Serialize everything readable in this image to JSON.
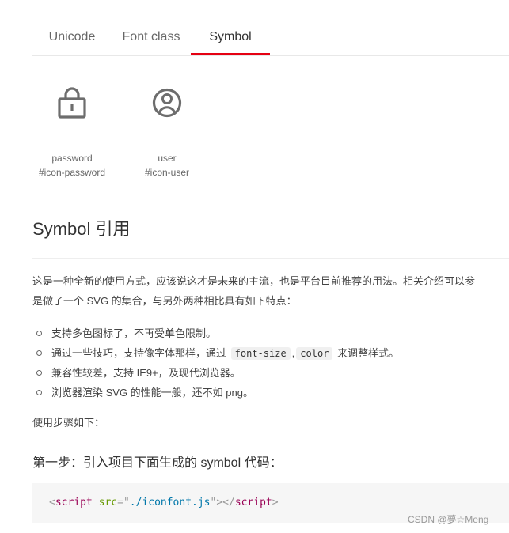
{
  "tabs": [
    {
      "label": "Unicode"
    },
    {
      "label": "Font class"
    },
    {
      "label": "Symbol"
    }
  ],
  "active_tab": "Symbol",
  "accent_color": "#e50012",
  "icons": [
    {
      "icon": "lock-icon",
      "name": "password",
      "code": "#icon-password"
    },
    {
      "icon": "user-icon",
      "name": "user",
      "code": "#icon-user"
    }
  ],
  "section": {
    "title": "Symbol 引用",
    "intro_line1": "这是一种全新的使用方式，应该说这才是未来的主流，也是平台目前推荐的用法。相关介绍可以参",
    "intro_line2": "是做了一个 SVG 的集合，与另外两种相比具有如下特点：",
    "features": {
      "f1": "支持多色图标了，不再受单色限制。",
      "f2_prefix": "通过一些技巧，支持像字体那样，通过",
      "f2_code1": "font-size",
      "f2_sep": ",",
      "f2_code2": "color",
      "f2_suffix": "来调整样式。",
      "f3": "兼容性较差，支持 IE9+，及现代浏览器。",
      "f4": "浏览器渲染 SVG 的性能一般，还不如 png。"
    },
    "steps_label": "使用步骤如下：",
    "step1_title": "第一步：引入项目下面生成的 symbol 代码：",
    "code": {
      "open_lt": "<",
      "tag": "script",
      "attr": "src",
      "eq": "=",
      "quote": "\"",
      "value": "./iconfont.js",
      "gt": ">",
      "close_lt": "</",
      "close_gt": ">"
    }
  },
  "watermark": "CSDN @夢☆Meng"
}
